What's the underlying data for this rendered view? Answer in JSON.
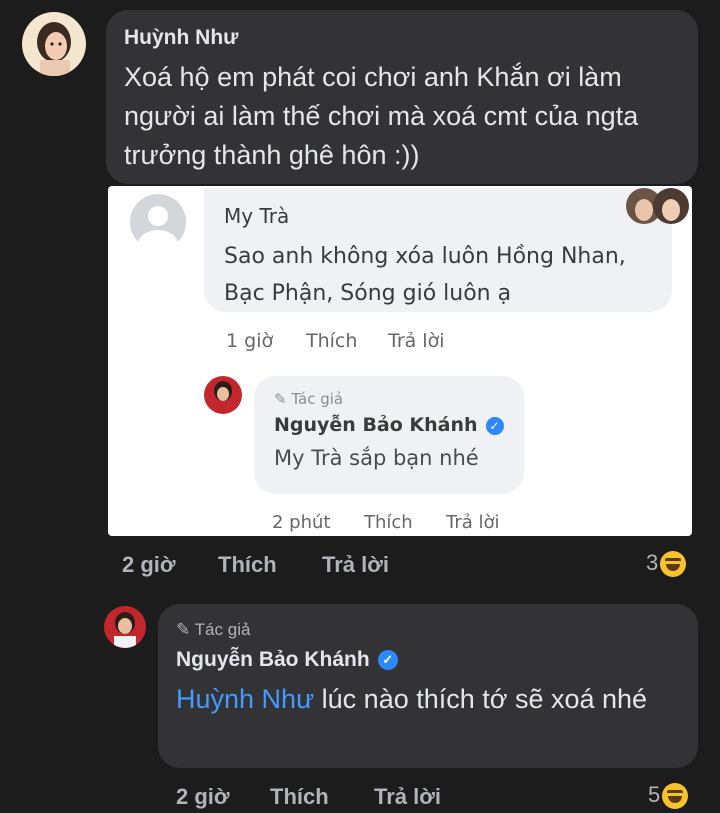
{
  "comment_main": {
    "author": "Huỳnh Như",
    "text": "Xoá hộ em phát coi chơi anh Khắn ơi làm người ai làm thế chơi mà xoá cmt của ngta trưởng thành ghê hôn :))",
    "time": "2 giờ",
    "like_label": "Thích",
    "reply_label": "Trả lời",
    "reaction_count": "3"
  },
  "screenshot": {
    "comment": {
      "author": "My Trà",
      "text": "Sao anh không xóa luôn Hồng Nhan, Bạc Phận, Sóng gió luôn ạ",
      "time": "1 giờ",
      "like_label": "Thích",
      "reply_label": "Trả lời"
    },
    "reply": {
      "author_tag": "Tác giả",
      "author": "Nguyễn Bảo Khánh",
      "text": "My Trà sắp bạn nhé",
      "time": "2 phút",
      "like_label": "Thích",
      "reply_label": "Trả lời"
    }
  },
  "reply_main": {
    "author_tag": "Tác giả",
    "author": "Nguyễn Bảo Khánh",
    "mention": "Huỳnh Như",
    "text": "lúc nào thích tớ sẽ xoá nhé",
    "time": "2 giờ",
    "like_label": "Thích",
    "reply_label": "Trả lời",
    "reaction_count": "5"
  },
  "colors": {
    "background": "#1c1c1d",
    "bubble": "#333336",
    "mention": "#4599ff",
    "verified": "#2d88ff"
  },
  "icons": {
    "verified": "verified-badge-icon",
    "pencil": "pencil-icon",
    "reaction": "laughing-emoji-icon"
  }
}
